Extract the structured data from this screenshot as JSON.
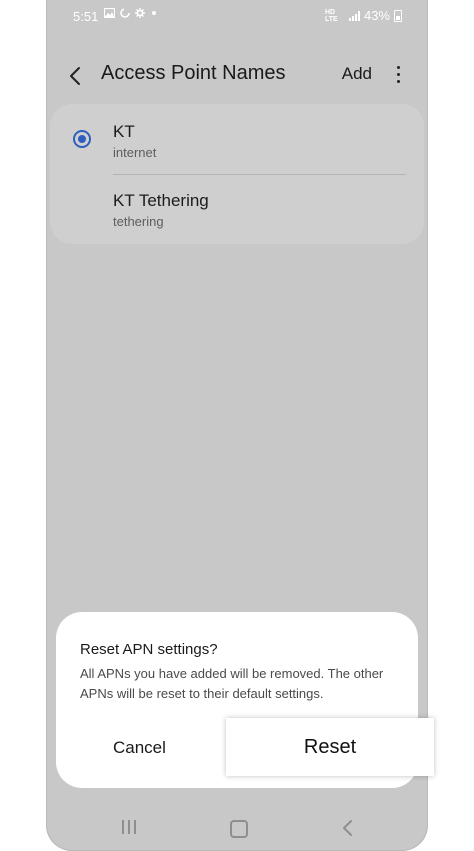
{
  "status_bar": {
    "time": "5:51",
    "indicators": [
      "gallery-icon",
      "sync-icon",
      "settings-icon",
      "dot-icon"
    ],
    "network": "HD LTE",
    "battery": "43%"
  },
  "app_bar": {
    "title": "Access Point Names",
    "add_label": "Add"
  },
  "apn_list": [
    {
      "name": "KT",
      "type": "internet",
      "selected": true
    },
    {
      "name": "KT Tethering",
      "type": "tethering",
      "selected": false
    }
  ],
  "dialog": {
    "title": "Reset APN settings?",
    "body": "All APNs you have added will be removed. The other APNs will be reset to their default settings.",
    "cancel_label": "Cancel",
    "reset_label": "Reset"
  },
  "colors": {
    "accent": "#2d5fc0",
    "overlay": "#c8c8c8",
    "dialog_bg": "#ffffff"
  }
}
